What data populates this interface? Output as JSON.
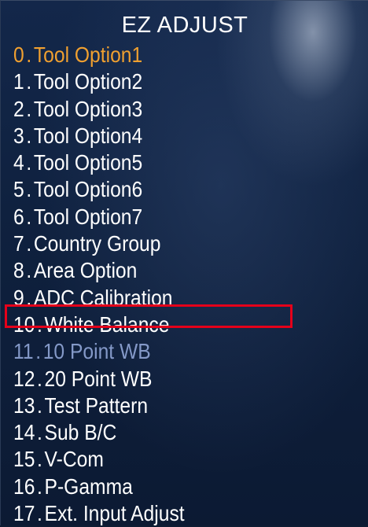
{
  "title": "EZ ADJUST",
  "colors": {
    "active": "#f0a030",
    "normal": "#ffffff",
    "disabled": "#8499c8",
    "highlight": "#e5001a"
  },
  "items": [
    {
      "num": "0",
      "label": "Tool Option1",
      "state": "active"
    },
    {
      "num": "1",
      "label": "Tool Option2",
      "state": "normal"
    },
    {
      "num": "2",
      "label": "Tool Option3",
      "state": "normal"
    },
    {
      "num": "3",
      "label": "Tool Option4",
      "state": "normal"
    },
    {
      "num": "4",
      "label": "Tool Option5",
      "state": "normal"
    },
    {
      "num": "5",
      "label": "Tool Option6",
      "state": "normal"
    },
    {
      "num": "6",
      "label": "Tool Option7",
      "state": "normal"
    },
    {
      "num": "7",
      "label": "Country Group",
      "state": "normal"
    },
    {
      "num": "8",
      "label": "Area Option",
      "state": "normal"
    },
    {
      "num": "9",
      "label": "ADC Calibration",
      "state": "normal"
    },
    {
      "num": "10",
      "label": "White Balance",
      "state": "highlighted"
    },
    {
      "num": "11",
      "label": "10 Point WB",
      "state": "disabled"
    },
    {
      "num": "12",
      "label": "20 Point WB",
      "state": "normal"
    },
    {
      "num": "13",
      "label": "Test Pattern",
      "state": "normal"
    },
    {
      "num": "14",
      "label": "Sub B/C",
      "state": "normal"
    },
    {
      "num": "15",
      "label": "V-Com",
      "state": "normal"
    },
    {
      "num": "16",
      "label": "P-Gamma",
      "state": "normal"
    },
    {
      "num": "17",
      "label": "Ext. Input Adjust",
      "state": "normal"
    }
  ]
}
